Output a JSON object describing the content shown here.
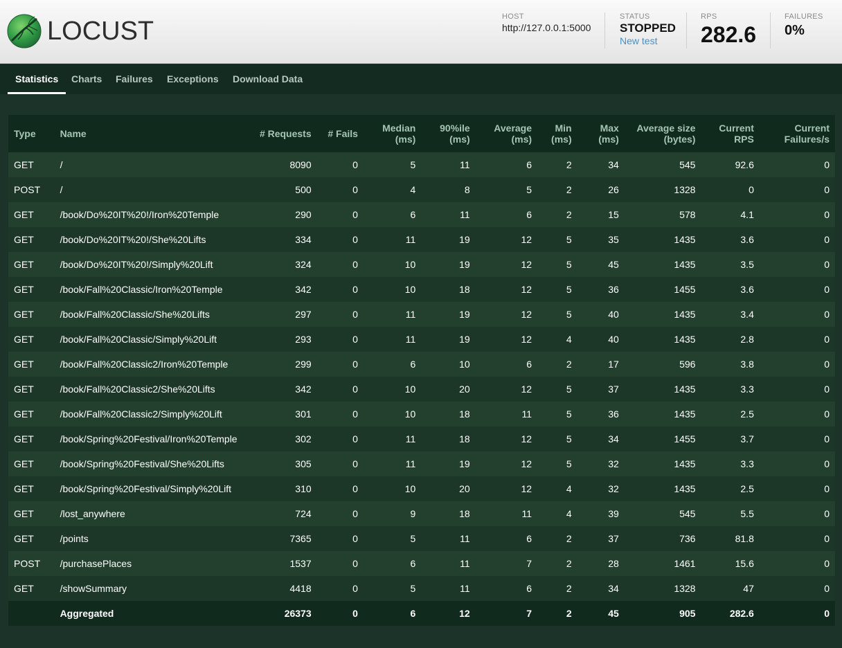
{
  "app": {
    "name": "LOCUST"
  },
  "header": {
    "host_label": "HOST",
    "host_value": "http://127.0.0.1:5000",
    "status_label": "STATUS",
    "status_value": "STOPPED",
    "new_test_label": "New test",
    "rps_label": "RPS",
    "rps_value": "282.6",
    "failures_label": "FAILURES",
    "failures_value": "0%"
  },
  "tabs": [
    {
      "label": "Statistics",
      "active": true
    },
    {
      "label": "Charts",
      "active": false
    },
    {
      "label": "Failures",
      "active": false
    },
    {
      "label": "Exceptions",
      "active": false
    },
    {
      "label": "Download Data",
      "active": false
    }
  ],
  "table": {
    "columns": [
      "Type",
      "Name",
      "# Requests",
      "# Fails",
      "Median\n(ms)",
      "90%ile\n(ms)",
      "Average\n(ms)",
      "Min\n(ms)",
      "Max\n(ms)",
      "Average size\n(bytes)",
      "Current\nRPS",
      "Current\nFailures/s"
    ],
    "rows": [
      [
        "GET",
        "/",
        "8090",
        "0",
        "5",
        "11",
        "6",
        "2",
        "34",
        "545",
        "92.6",
        "0"
      ],
      [
        "POST",
        "/",
        "500",
        "0",
        "4",
        "8",
        "5",
        "2",
        "26",
        "1328",
        "0",
        "0"
      ],
      [
        "GET",
        "/book/Do%20IT%20!/Iron%20Temple",
        "290",
        "0",
        "6",
        "11",
        "6",
        "2",
        "15",
        "578",
        "4.1",
        "0"
      ],
      [
        "GET",
        "/book/Do%20IT%20!/She%20Lifts",
        "334",
        "0",
        "11",
        "19",
        "12",
        "5",
        "35",
        "1435",
        "3.6",
        "0"
      ],
      [
        "GET",
        "/book/Do%20IT%20!/Simply%20Lift",
        "324",
        "0",
        "10",
        "19",
        "12",
        "5",
        "45",
        "1435",
        "3.5",
        "0"
      ],
      [
        "GET",
        "/book/Fall%20Classic/Iron%20Temple",
        "342",
        "0",
        "10",
        "18",
        "12",
        "5",
        "36",
        "1455",
        "3.6",
        "0"
      ],
      [
        "GET",
        "/book/Fall%20Classic/She%20Lifts",
        "297",
        "0",
        "11",
        "19",
        "12",
        "5",
        "40",
        "1435",
        "3.4",
        "0"
      ],
      [
        "GET",
        "/book/Fall%20Classic/Simply%20Lift",
        "293",
        "0",
        "11",
        "19",
        "12",
        "4",
        "40",
        "1435",
        "2.8",
        "0"
      ],
      [
        "GET",
        "/book/Fall%20Classic2/Iron%20Temple",
        "299",
        "0",
        "6",
        "10",
        "6",
        "2",
        "17",
        "596",
        "3.8",
        "0"
      ],
      [
        "GET",
        "/book/Fall%20Classic2/She%20Lifts",
        "342",
        "0",
        "10",
        "20",
        "12",
        "5",
        "37",
        "1435",
        "3.3",
        "0"
      ],
      [
        "GET",
        "/book/Fall%20Classic2/Simply%20Lift",
        "301",
        "0",
        "10",
        "18",
        "11",
        "5",
        "36",
        "1435",
        "2.5",
        "0"
      ],
      [
        "GET",
        "/book/Spring%20Festival/Iron%20Temple",
        "302",
        "0",
        "11",
        "18",
        "12",
        "5",
        "34",
        "1455",
        "3.7",
        "0"
      ],
      [
        "GET",
        "/book/Spring%20Festival/She%20Lifts",
        "305",
        "0",
        "11",
        "19",
        "12",
        "5",
        "32",
        "1435",
        "3.3",
        "0"
      ],
      [
        "GET",
        "/book/Spring%20Festival/Simply%20Lift",
        "310",
        "0",
        "10",
        "20",
        "12",
        "4",
        "32",
        "1435",
        "2.5",
        "0"
      ],
      [
        "GET",
        "/lost_anywhere",
        "724",
        "0",
        "9",
        "18",
        "11",
        "4",
        "39",
        "545",
        "5.5",
        "0"
      ],
      [
        "GET",
        "/points",
        "7365",
        "0",
        "5",
        "11",
        "6",
        "2",
        "37",
        "736",
        "81.8",
        "0"
      ],
      [
        "POST",
        "/purchasePlaces",
        "1537",
        "0",
        "6",
        "11",
        "7",
        "2",
        "28",
        "1461",
        "15.6",
        "0"
      ],
      [
        "GET",
        "/showSummary",
        "4418",
        "0",
        "5",
        "11",
        "6",
        "2",
        "34",
        "1328",
        "47",
        "0"
      ]
    ],
    "aggregated": [
      "",
      "Aggregated",
      "26373",
      "0",
      "6",
      "12",
      "7",
      "2",
      "45",
      "905",
      "282.6",
      "0"
    ]
  },
  "colors": {
    "page_bg": "#1b3329",
    "tab_bar_bg": "#132b21",
    "header_row_bg": "#102a1d",
    "row_odd_bg": "#23402f",
    "row_even_bg": "#1c3728",
    "header_text": "#a6c5b3",
    "link": "#4a8fbf",
    "logo_green": "#2f9a46"
  },
  "icons": {
    "logo": "locust-logo-icon"
  }
}
